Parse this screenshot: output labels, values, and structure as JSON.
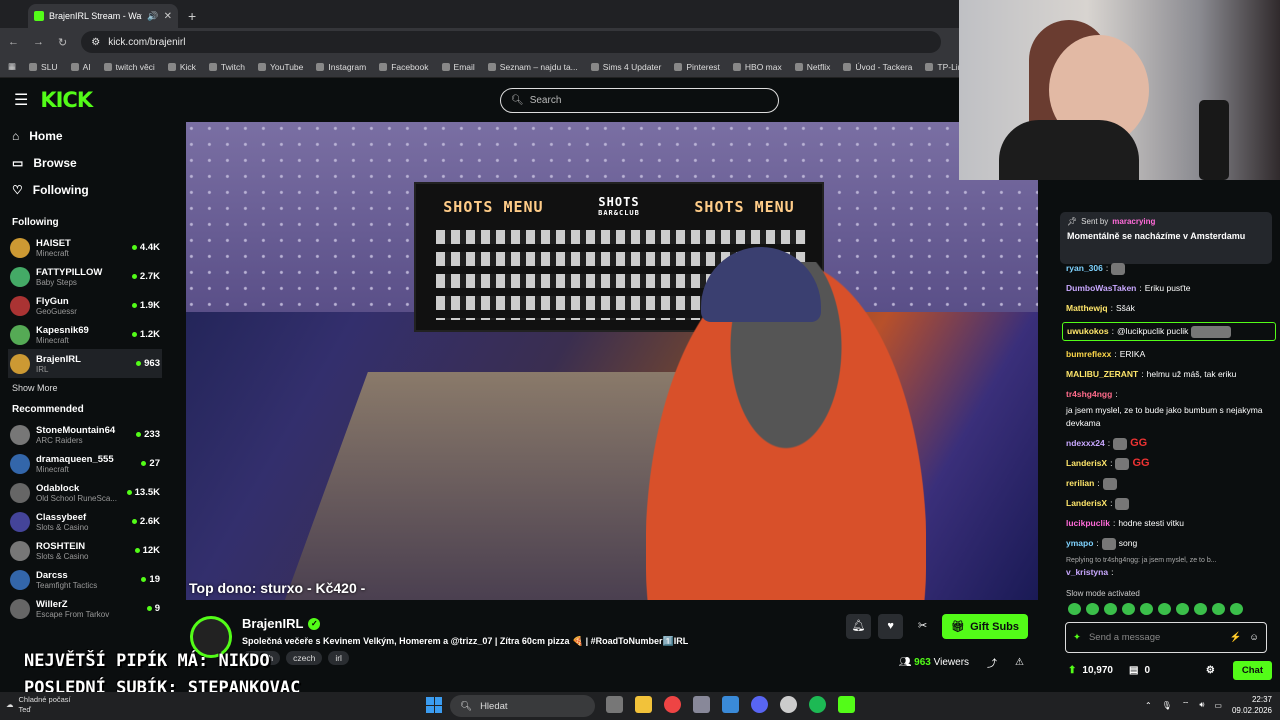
{
  "browser": {
    "tab_title": "BrajenIRL Stream - Watch L",
    "url": "kick.com/brajenirl",
    "bookmarks": [
      "SLU",
      "AI",
      "twitch věci",
      "Kick",
      "Twitch",
      "YouTube",
      "Instagram",
      "Facebook",
      "Email",
      "Seznam – najdu ta...",
      "Sims 4 Updater",
      "Pinterest",
      "HBO max",
      "Netflix",
      "Úvod - Tackera",
      "TP-Link T"
    ]
  },
  "kick": {
    "logo": "KICK",
    "search_placeholder": "Search",
    "nav": [
      {
        "label": "Home",
        "icon": "home-icon"
      },
      {
        "label": "Browse",
        "icon": "browse-icon"
      },
      {
        "label": "Following",
        "icon": "heart-icon"
      }
    ],
    "following_title": "Following",
    "following": [
      {
        "name": "HAISET",
        "category": "Minecraft",
        "viewers": "4.4K"
      },
      {
        "name": "FATTYPILLOW",
        "category": "Baby Steps",
        "viewers": "2.7K"
      },
      {
        "name": "FlyGun",
        "category": "GeoGuessr",
        "viewers": "1.9K"
      },
      {
        "name": "Kapesnik69",
        "category": "Minecraft",
        "viewers": "1.2K"
      },
      {
        "name": "BrajenIRL",
        "category": "IRL",
        "viewers": "963"
      }
    ],
    "show_more": "Show More",
    "recommended_title": "Recommended",
    "recommended": [
      {
        "name": "StoneMountain64",
        "category": "ARC Raiders",
        "viewers": "233"
      },
      {
        "name": "dramaqueen_555",
        "category": "Minecraft",
        "viewers": "27"
      },
      {
        "name": "Odablock",
        "category": "Old School RuneSca...",
        "viewers": "13.5K"
      },
      {
        "name": "Classybeef",
        "category": "Slots & Casino",
        "viewers": "2.6K"
      },
      {
        "name": "ROSHTEIN",
        "category": "Slots & Casino",
        "viewers": "12K"
      },
      {
        "name": "Darcss",
        "category": "Teamfight Tactics",
        "viewers": "19"
      },
      {
        "name": "WillerZ",
        "category": "Escape From Tarkov",
        "viewers": "9"
      }
    ]
  },
  "video": {
    "menu_left": "SHOTS MENU",
    "menu_logo": "SHOTS",
    "menu_logo_sub": "BAR&CLUB",
    "menu_right": "SHOTS MENU",
    "top_dono": "Top dono: sturxo - Kč420 -"
  },
  "overlay": {
    "line1": "NEJVĚTŠÍ PIPÍK MÁ: NIKDO",
    "line2": "POSLEDNÍ SUBÍK: STEPANKOVAC"
  },
  "stream": {
    "streamer": "BrajenIRL",
    "title": "Společná večeře s Kevinem Velkým, Homerem a @trizz_07  | Zítra 60cm pizza 🍕  | #RoadToNumber1️⃣IRL",
    "tags": [
      "Czech",
      "czech",
      "irl"
    ],
    "gift_label": "Gift Subs",
    "viewers_count": "963",
    "viewers_label": "Viewers"
  },
  "chat": {
    "pinned_prefix": "Sent by",
    "pinned_user": "maracrying",
    "pinned_message": "Momentálně se nacházíme v Amsterdamu",
    "messages": [
      {
        "user": "ryan_306",
        "text": "",
        "color": "#7fd3ff"
      },
      {
        "user": "DumboWasTaken",
        "text": "Eriku pusťte",
        "color": "#c9a8ff"
      },
      {
        "user": "Matthewjq",
        "text": "Sšák",
        "color": "#ffe66b"
      },
      {
        "user": "uwukokos",
        "text": "@lucikpuclik puclik",
        "color": "#ffe66b"
      },
      {
        "user": "bumreflexx",
        "text": "ERIKA",
        "color": "#ffd84a"
      },
      {
        "user": "MALIBU_ZERANT",
        "text": "helmu už máš, tak eriku",
        "color": "#ffe66b"
      },
      {
        "user": "tr4shg4ngg",
        "text": "ja jsem myslel, ze to bude jako bumbum s nejakyma devkama",
        "color": "#ff6b8b"
      },
      {
        "user": "ndexxx24",
        "text": "GG",
        "color": "#c9a8ff"
      },
      {
        "user": "LanderisX",
        "text": "GG",
        "color": "#ffe66b"
      },
      {
        "user": "rerilian",
        "text": "",
        "color": "#ffe66b"
      },
      {
        "user": "LanderisX",
        "text": "",
        "color": "#ffe66b"
      },
      {
        "user": "lucikpuclik",
        "text": "hodne stesti vitku",
        "color": "#ff6bd9"
      },
      {
        "user": "ymapo",
        "text": "song",
        "color": "#7fd3ff"
      }
    ],
    "reply_hint": "Replying to tr4shg4ngg: ja jsem myslel, ze to b...",
    "last_user": "v_kristyna",
    "slow_mode": "Slow mode activated",
    "input_placeholder": "Send a message",
    "points": "10,970",
    "store_count": "0",
    "chat_button": "Chat"
  },
  "taskbar": {
    "weather_line1": "Chladné počasí",
    "weather_line2": "Teď",
    "search": "Hledat",
    "time": "22:37",
    "date": "09.02.2026"
  }
}
